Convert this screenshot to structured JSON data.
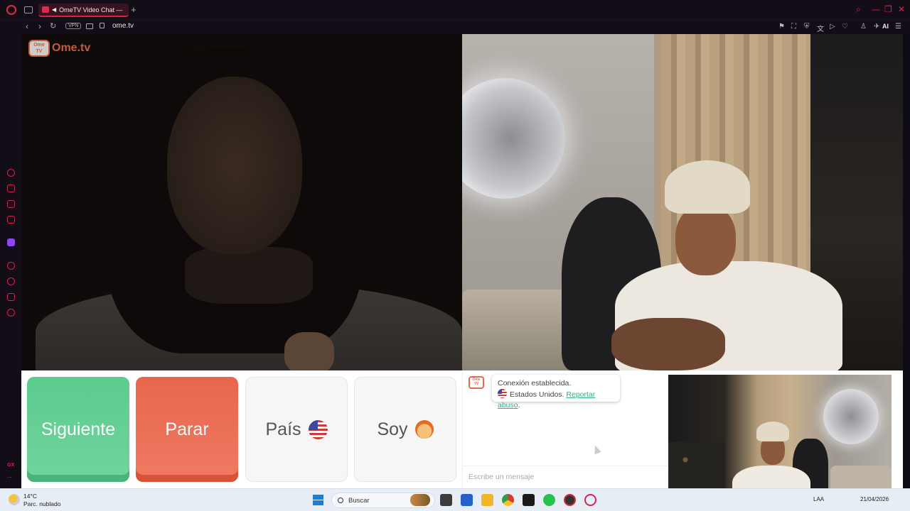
{
  "browser": {
    "tab_title": "OmeTV Video Chat — ",
    "new_tab": "+",
    "url": "ome.tv",
    "vpn_label": "VPN",
    "ai_label": "AI"
  },
  "sidebar": {
    "gx_label": "GX",
    "more_label": "···"
  },
  "site": {
    "logo_small": "Ome TV",
    "logo_word": "Ome.tv"
  },
  "controls": {
    "next_label": "Siguiente",
    "stop_label": "Parar",
    "country_label": "País",
    "me_label": "Soy"
  },
  "chat": {
    "tv_logo": "Ome TV",
    "status_line": "Conexión establecida.",
    "country_text": "Estados Unidos.",
    "report_link": "Reportar abuso",
    "report_suffix": ".",
    "input_placeholder": "Escribe un mensaje"
  },
  "taskbar": {
    "temperature": "14°C",
    "weather_desc": "Parc. nublado",
    "search_label": "Buscar",
    "lang": "LAA",
    "date": "21/04/2026"
  }
}
